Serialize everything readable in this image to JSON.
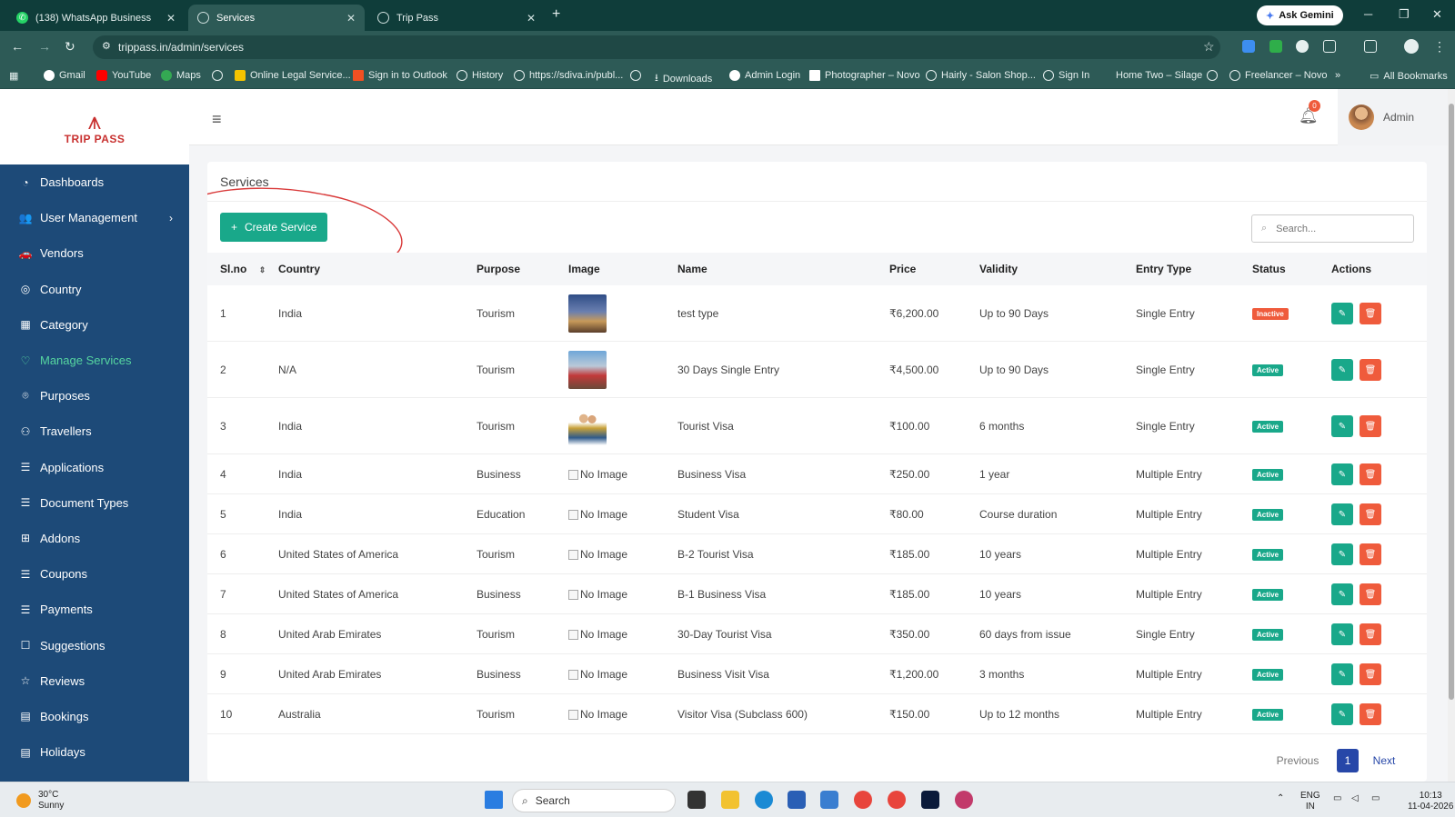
{
  "browser": {
    "tabs": [
      {
        "title": "(138) WhatsApp Business",
        "active": false
      },
      {
        "title": "Services",
        "active": true
      },
      {
        "title": "Trip Pass",
        "active": false
      }
    ],
    "ask_gemini": "Ask Gemini",
    "url": "trippass.in/admin/services",
    "bookmarks": [
      "Gmail",
      "YouTube",
      "Maps",
      "Online Legal Service...",
      "Sign in to Outlook",
      "History",
      "https://sdiva.in/publ...",
      "Downloads",
      "Admin Login",
      "Photographer – Novo",
      "Hairly - Salon Shop...",
      "Sign In",
      "Home Two – Silage",
      "Freelancer – Novo",
      "All Bookmarks"
    ]
  },
  "sidebar": {
    "logo_text": "TRIP PASS",
    "items": [
      {
        "label": "Dashboards",
        "icon": "dashboard-icon",
        "glyph": "◔"
      },
      {
        "label": "User Management",
        "icon": "users-icon",
        "glyph": "👥",
        "has_chevron": true
      },
      {
        "label": "Vendors",
        "icon": "vendor-icon",
        "glyph": "🚗"
      },
      {
        "label": "Country",
        "icon": "globe-icon",
        "glyph": "◎"
      },
      {
        "label": "Category",
        "icon": "grid-icon",
        "glyph": "▦"
      },
      {
        "label": "Manage Services",
        "icon": "services-icon",
        "glyph": "♡",
        "active": true
      },
      {
        "label": "Purposes",
        "icon": "location-icon",
        "glyph": "⌾"
      },
      {
        "label": "Travellers",
        "icon": "person-icon",
        "glyph": "⚇"
      },
      {
        "label": "Applications",
        "icon": "document-icon",
        "glyph": "☰"
      },
      {
        "label": "Document Types",
        "icon": "file-icon",
        "glyph": "☰"
      },
      {
        "label": "Addons",
        "icon": "gift-icon",
        "glyph": "⊞"
      },
      {
        "label": "Coupons",
        "icon": "coupon-icon",
        "glyph": "☰"
      },
      {
        "label": "Payments",
        "icon": "payment-icon",
        "glyph": "☰"
      },
      {
        "label": "Suggestions",
        "icon": "chat-icon",
        "glyph": "☐"
      },
      {
        "label": "Reviews",
        "icon": "star-icon",
        "glyph": "☆"
      },
      {
        "label": "Bookings",
        "icon": "calendar-icon",
        "glyph": "▤"
      },
      {
        "label": "Holidays",
        "icon": "holiday-icon",
        "glyph": "▤"
      }
    ]
  },
  "topbar": {
    "notification_count": "0",
    "admin_name": "Admin"
  },
  "card": {
    "title": "Services",
    "create_button": "Create Service",
    "search_placeholder": "Search..."
  },
  "table": {
    "headers": [
      "Sl.no",
      "Country",
      "Purpose",
      "Image",
      "Name",
      "Price",
      "Validity",
      "Entry Type",
      "Status",
      "Actions"
    ],
    "no_image_text": "No Image",
    "rows": [
      {
        "slno": "1",
        "country": "India",
        "purpose": "Tourism",
        "image": "photo-opera-house",
        "name": "test type",
        "price": "₹6,200.00",
        "validity": "Up to 90 Days",
        "entry": "Single Entry",
        "status": "Inactive"
      },
      {
        "slno": "2",
        "country": "N/A",
        "purpose": "Tourism",
        "image": "photo-castle",
        "name": "30 Days Single Entry",
        "price": "₹4,500.00",
        "validity": "Up to 90 Days",
        "entry": "Single Entry",
        "status": "Active"
      },
      {
        "slno": "3",
        "country": "India",
        "purpose": "Tourism",
        "image": "photo-travellers",
        "name": "Tourist Visa",
        "price": "₹100.00",
        "validity": "6 months",
        "entry": "Single Entry",
        "status": "Active"
      },
      {
        "slno": "4",
        "country": "India",
        "purpose": "Business",
        "image": "",
        "name": "Business Visa",
        "price": "₹250.00",
        "validity": "1 year",
        "entry": "Multiple Entry",
        "status": "Active"
      },
      {
        "slno": "5",
        "country": "India",
        "purpose": "Education",
        "image": "",
        "name": "Student Visa",
        "price": "₹80.00",
        "validity": "Course duration",
        "entry": "Multiple Entry",
        "status": "Active"
      },
      {
        "slno": "6",
        "country": "United States of America",
        "purpose": "Tourism",
        "image": "",
        "name": "B-2 Tourist Visa",
        "price": "₹185.00",
        "validity": "10 years",
        "entry": "Multiple Entry",
        "status": "Active"
      },
      {
        "slno": "7",
        "country": "United States of America",
        "purpose": "Business",
        "image": "",
        "name": "B-1 Business Visa",
        "price": "₹185.00",
        "validity": "10 years",
        "entry": "Multiple Entry",
        "status": "Active"
      },
      {
        "slno": "8",
        "country": "United Arab Emirates",
        "purpose": "Tourism",
        "image": "",
        "name": "30-Day Tourist Visa",
        "price": "₹350.00",
        "validity": "60 days from issue",
        "entry": "Single Entry",
        "status": "Active"
      },
      {
        "slno": "9",
        "country": "United Arab Emirates",
        "purpose": "Business",
        "image": "",
        "name": "Business Visit Visa",
        "price": "₹1,200.00",
        "validity": "3 months",
        "entry": "Multiple Entry",
        "status": "Active"
      },
      {
        "slno": "10",
        "country": "Australia",
        "purpose": "Tourism",
        "image": "",
        "name": "Visitor Visa (Subclass 600)",
        "price": "₹150.00",
        "validity": "Up to 12 months",
        "entry": "Multiple Entry",
        "status": "Active"
      }
    ]
  },
  "pagination": {
    "previous": "Previous",
    "current": "1",
    "next": "Next"
  },
  "taskbar": {
    "weather_temp": "30°C",
    "weather_desc": "Sunny",
    "search": "Search",
    "lang1": "ENG",
    "lang2": "IN",
    "time": "10:13",
    "date": "11-04-2026"
  },
  "colors": {
    "sidebar": "#1d4a78",
    "accent": "#19a88a",
    "danger": "#ef5b3c",
    "active_nav": "#56d6a0"
  }
}
